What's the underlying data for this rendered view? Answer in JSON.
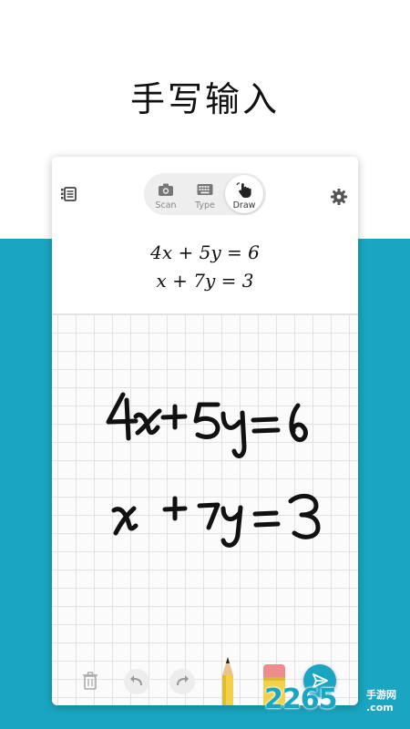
{
  "headline": "手写输入",
  "modes": [
    {
      "label": "Scan",
      "icon": "camera-icon",
      "active": false
    },
    {
      "label": "Type",
      "icon": "keyboard-icon",
      "active": false
    },
    {
      "label": "Draw",
      "icon": "hand-pointer-icon",
      "active": true
    }
  ],
  "equations": {
    "line1": "4x + 5y = 6",
    "line2": "x + 7y = 3"
  },
  "handwriting": {
    "line1": "4x+5y=6",
    "line2": "x+7y=3"
  },
  "toolbar": {
    "tools": [
      "trash-icon",
      "undo-icon",
      "redo-icon",
      "pencil-icon",
      "eraser-icon",
      "send-icon"
    ]
  },
  "watermark": {
    "number": "2265",
    "cn": "手游网",
    "domain": ".com"
  },
  "colors": {
    "accent": "#1aa6c2",
    "background_top": "#ffffff",
    "grid_line": "#e2e2e2"
  }
}
